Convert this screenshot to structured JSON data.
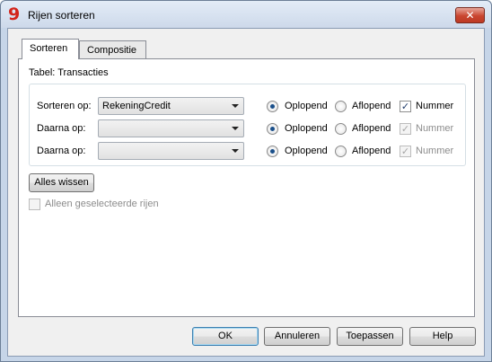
{
  "window": {
    "title": "Rijen sorteren",
    "logo_glyph": "9",
    "close_glyph": "✕"
  },
  "tabs": [
    {
      "label": "Sorteren",
      "active": true
    },
    {
      "label": "Compositie",
      "active": false
    }
  ],
  "panel": {
    "table_label": "Tabel: Transacties",
    "rows": [
      {
        "label": "Sorteren op:",
        "value": "RekeningCredit",
        "ascending_label": "Oplopend",
        "descending_label": "Aflopend",
        "ascending_selected": true,
        "number_label": "Nummer",
        "number_checked": true,
        "number_enabled": true
      },
      {
        "label": "Daarna op:",
        "value": "",
        "ascending_label": "Oplopend",
        "descending_label": "Aflopend",
        "ascending_selected": true,
        "number_label": "Nummer",
        "number_checked": true,
        "number_enabled": false
      },
      {
        "label": "Daarna op:",
        "value": "",
        "ascending_label": "Oplopend",
        "descending_label": "Aflopend",
        "ascending_selected": true,
        "number_label": "Nummer",
        "number_checked": true,
        "number_enabled": false
      }
    ],
    "check_glyph": "✓",
    "clear_button": "Alles wissen",
    "selected_only_label": "Alleen geselecteerde rijen",
    "selected_only_checked": false
  },
  "footer": {
    "ok": "OK",
    "cancel": "Annuleren",
    "apply": "Toepassen",
    "help": "Help"
  },
  "colors": {
    "frame": "#c6d5e8",
    "accent": "#3c7fb1",
    "close": "#c9452f"
  }
}
